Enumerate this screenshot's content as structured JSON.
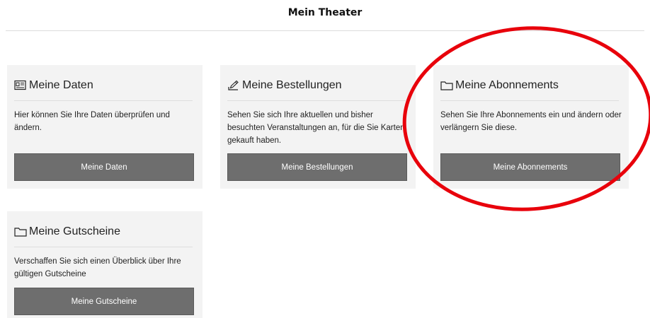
{
  "page": {
    "title": "Mein Theater"
  },
  "cards": [
    {
      "icon": "id-card-icon",
      "title": "Meine Daten",
      "description": "Hier können Sie Ihre Daten überprüfen und ändern.",
      "button_label": "Meine Daten"
    },
    {
      "icon": "edit-note-icon",
      "title": "Meine Bestellungen",
      "description": "Sehen Sie sich Ihre aktuellen und bisher besuchten Veranstaltungen an, für die Sie Karten gekauft haben.",
      "button_label": "Meine Bestellungen"
    },
    {
      "icon": "folder-icon",
      "title": "Meine Abonnements",
      "description": "Sehen Sie Ihre Abonnements ein und ändern oder verlängern Sie diese.",
      "button_label": "Meine Abonnements"
    },
    {
      "icon": "folder-icon",
      "title": "Meine Gutscheine",
      "description": "Verschaffen Sie sich einen Überblick über Ihre gültigen Gutscheine",
      "button_label": "Meine Gutscheine"
    }
  ],
  "colors": {
    "card_background": "#f3f3f3",
    "button_background": "#6e6e6e",
    "annotation_circle": "#e8000b"
  }
}
